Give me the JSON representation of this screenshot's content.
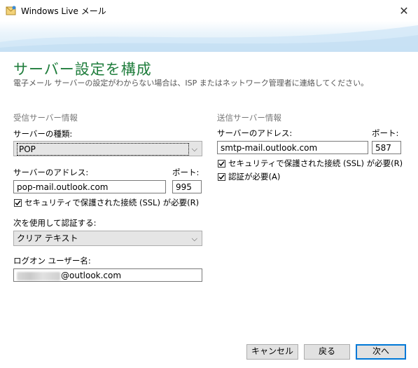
{
  "window": {
    "title": "Windows Live メール",
    "close_icon": "close-icon"
  },
  "page": {
    "heading": "サーバー設定を構成",
    "subheading": "電子メール サーバーの設定がわからない場合は、ISP またはネットワーク管理者に連絡してください。"
  },
  "incoming": {
    "group_label": "受信サーバー情報",
    "server_type_label": "サーバーの種類:",
    "server_type_value": "POP",
    "address_label": "サーバーのアドレス:",
    "address_value": "pop-mail.outlook.com",
    "port_label": "ポート:",
    "port_value": "995",
    "ssl_label": "セキュリティで保護された接続 (SSL) が必要(R)",
    "ssl_checked": true,
    "auth_label": "次を使用して認証する:",
    "auth_value": "クリア テキスト",
    "logon_label": "ログオン ユーザー名:",
    "logon_value": "@outlook.com"
  },
  "outgoing": {
    "group_label": "送信サーバー情報",
    "address_label": "サーバーのアドレス:",
    "address_value": "smtp-mail.outlook.com",
    "port_label": "ポート:",
    "port_value": "587",
    "ssl_label": "セキュリティで保護された接続 (SSL) が必要(R)",
    "ssl_checked": true,
    "auth_required_label": "認証が必要(A)",
    "auth_required_checked": true
  },
  "buttons": {
    "cancel": "キャンセル",
    "back": "戻る",
    "next": "次へ"
  },
  "colors": {
    "heading": "#1f7d3c",
    "default_button_border": "#0078d7"
  }
}
